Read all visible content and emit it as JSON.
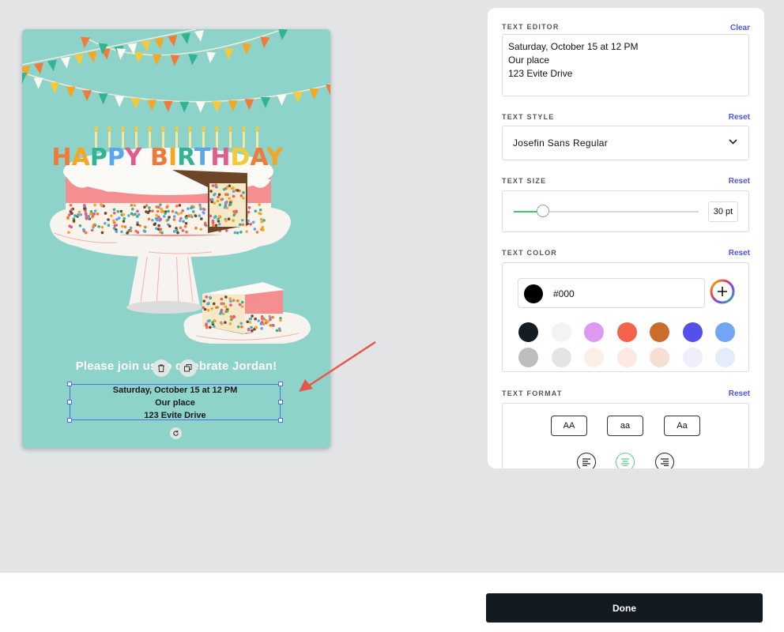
{
  "card": {
    "cake_title": "HAPPY BIRTHDAY",
    "invite_line": "Please join us to celebrate Jordan!",
    "details": [
      "Saturday, October 15 at 12 PM",
      "Our place",
      "123 Evite Drive"
    ]
  },
  "panel": {
    "text_editor": {
      "label": "TEXT EDITOR",
      "action": "Clear",
      "lines": [
        "Saturday, October 15 at 12 PM",
        "Our place",
        "123 Evite Drive"
      ]
    },
    "text_style": {
      "label": "TEXT STYLE",
      "action": "Reset",
      "value": "Josefin Sans Regular"
    },
    "text_size": {
      "label": "TEXT SIZE",
      "action": "Reset",
      "value": "30 pt",
      "slider_fraction": 0.16
    },
    "text_color": {
      "label": "TEXT COLOR",
      "action": "Reset",
      "hex": "#000",
      "swatches": [
        "#141c24",
        "#f3f3f3",
        "#df98f1",
        "#f4644c",
        "#c96c2c",
        "#5650ea",
        "#72a6f2",
        "#bdbdbd",
        "#e3e4e6",
        "#fcefe7",
        "#fde9e4",
        "#f4dfd2",
        "#efeefc",
        "#e4ecfb"
      ]
    },
    "text_format": {
      "label": "TEXT FORMAT",
      "action": "Reset",
      "case_buttons": [
        "AA",
        "aa",
        "Aa"
      ],
      "active_alignment": "center"
    }
  },
  "footer": {
    "done_label": "Done"
  },
  "colors": {
    "accent": "#4d55e0",
    "card_bg": "#8ed3ca",
    "selection": "#4d6ee8",
    "arrow": "#e4574a",
    "slider": "#3ec86a"
  }
}
